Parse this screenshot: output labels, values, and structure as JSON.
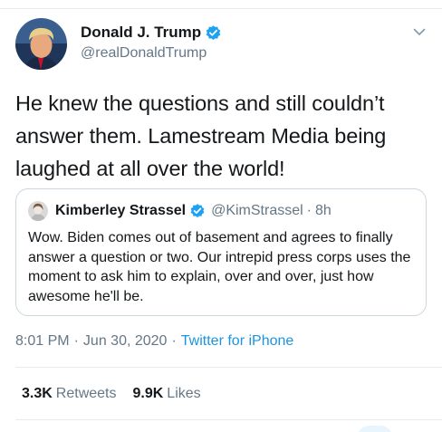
{
  "author": {
    "display_name": "Donald J. Trump",
    "handle": "@realDonaldTrump",
    "verified": true
  },
  "tweet": {
    "text": "He knew the questions and still couldn’t answer them. Lamestream Media being laughed at all over the world!"
  },
  "quoted_tweet": {
    "display_name": "Kimberley Strassel",
    "handle": "@KimStrassel",
    "separator": "·",
    "time": "8h",
    "verified": true,
    "text": "Wow. Biden comes out of basement and agrees to finally answer a question or two. Our intrepid press corps uses the moment to ask him to explain, over and over, just how awesome he'll be."
  },
  "meta": {
    "time": "8:01 PM",
    "separator_1": "·",
    "date": "Jun 30, 2020",
    "separator_2": "·",
    "source": "Twitter for iPhone"
  },
  "stats": {
    "retweets_count": "3.3K",
    "retweets_label": "Retweets",
    "likes_count": "9.9K",
    "likes_label": "Likes"
  },
  "colors": {
    "accent": "#1da1f2",
    "link": "#1b95e0",
    "secondary_text": "#657786",
    "border": "#e6ecf0"
  },
  "icons": {
    "verified": "verified-badge-icon",
    "caret": "chevron-down-icon"
  }
}
